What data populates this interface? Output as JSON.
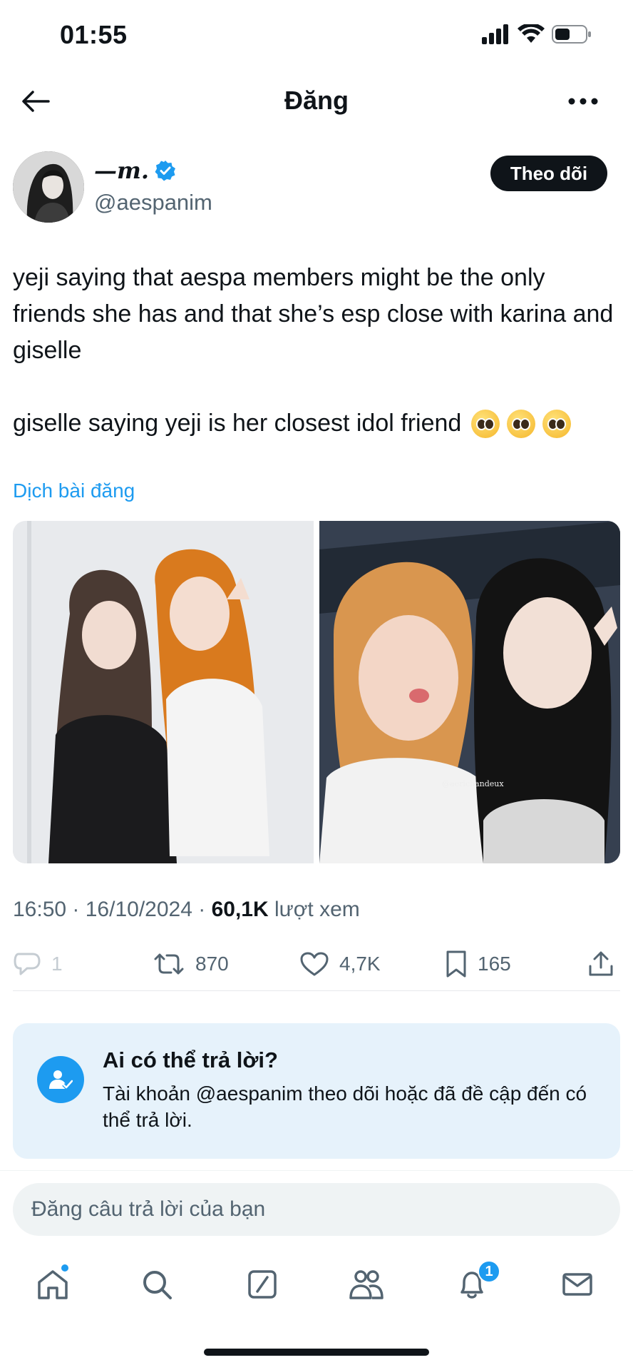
{
  "status": {
    "time": "01:55"
  },
  "nav": {
    "title": "Đăng"
  },
  "author": {
    "name": "—m.",
    "handle": "@aespanim",
    "follow_label": "Theo dõi"
  },
  "tweet": {
    "text_line1": "yeji saying that aespa members might be the only friends she has and that she’s esp close with karina and giselle",
    "text_line2": "giselle saying yeji is her closest idol friend",
    "emojis": [
      "pleading-face",
      "pleading-face",
      "pleading-face"
    ],
    "translate_label": "Dịch bài đăng",
    "photo_watermark": "@aerichandeux"
  },
  "meta": {
    "time": "16:50",
    "date": "16/10/2024",
    "views_count": "60,1K",
    "views_label": "lượt xem"
  },
  "actions": {
    "replies": "1",
    "retweets": "870",
    "likes": "4,7K",
    "bookmarks": "165"
  },
  "reply_card": {
    "title": "Ai có thể trả lời?",
    "body": "Tài khoản @aespanim theo dõi hoặc đã đề cập đến có thể trả lời."
  },
  "reply_input": {
    "placeholder": "Đăng câu trả lời của bạn"
  },
  "tabs": {
    "notifications_badge": "1"
  },
  "colors": {
    "accent": "#1d9bf0",
    "text": "#0f1419",
    "muted": "#536471",
    "card_bg": "#e6f2fb"
  }
}
